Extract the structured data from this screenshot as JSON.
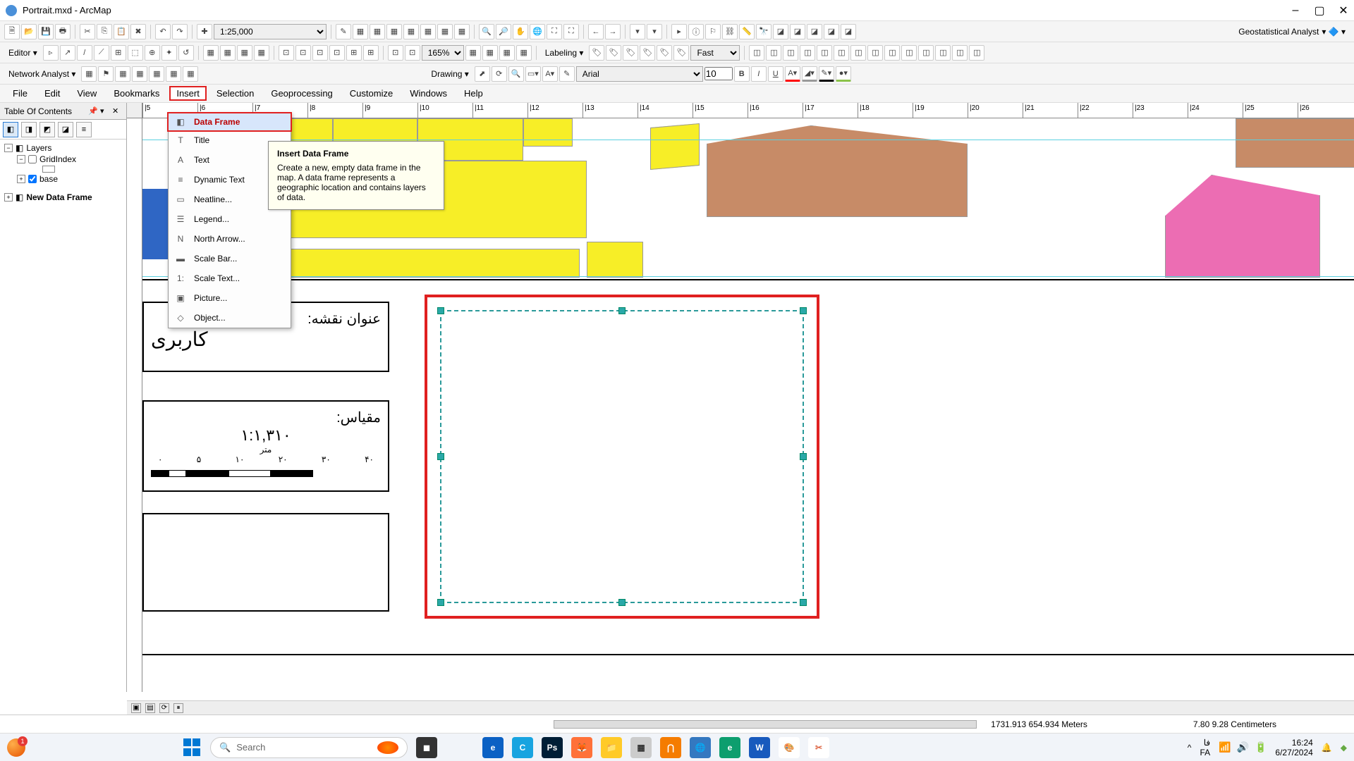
{
  "titlebar": {
    "title": "Portrait.mxd - ArcMap"
  },
  "toolbar1": {
    "scale": "1:25,000",
    "zoom": "165%",
    "geo_label": "Geostatistical Analyst"
  },
  "toolbar2": {
    "editor_label": "Editor",
    "labeling_label": "Labeling",
    "fast_label": "Fast"
  },
  "toolbar3": {
    "na_label": "Network Analyst",
    "draw_label": "Drawing",
    "font": "Arial",
    "fontsize": "10",
    "bold": "B",
    "italic": "I",
    "underline": "U"
  },
  "menubar": [
    "File",
    "Edit",
    "View",
    "Bookmarks",
    "Insert",
    "Selection",
    "Geoprocessing",
    "Customize",
    "Windows",
    "Help"
  ],
  "menubar_highlight_index": 4,
  "toc": {
    "title": "Table Of Contents",
    "layers_label": "Layers",
    "grid_label": "GridIndex",
    "base_label": "base",
    "new_frame_label": "New Data Frame"
  },
  "ruler_h": [
    "5",
    "6",
    "7",
    "8",
    "9",
    "10",
    "11",
    "12",
    "13",
    "14",
    "15",
    "16",
    "17",
    "18",
    "19",
    "20",
    "21",
    "22",
    "23",
    "24",
    "25",
    "26"
  ],
  "insert_menu": {
    "items": [
      {
        "label": "Data Frame",
        "icon": "◧"
      },
      {
        "label": "Title",
        "icon": "T"
      },
      {
        "label": "Text",
        "icon": "A"
      },
      {
        "label": "Dynamic Text",
        "icon": "≡",
        "arrow": true
      },
      {
        "label": "Neatline...",
        "icon": "▭"
      },
      {
        "label": "Legend...",
        "icon": "☰"
      },
      {
        "label": "North Arrow...",
        "icon": "N"
      },
      {
        "label": "Scale Bar...",
        "icon": "▬"
      },
      {
        "label": "Scale Text...",
        "icon": "1:"
      },
      {
        "label": "Picture...",
        "icon": "▣"
      },
      {
        "label": "Object...",
        "icon": "◇"
      }
    ],
    "highlight_index": 0
  },
  "tooltip": {
    "title": "Insert Data Frame",
    "body": "Create a new, empty data frame in the map. A data frame represents a geographic location and contains layers of data."
  },
  "layout": {
    "title_label": "عنوان نقشه:",
    "title_value": "کاربری",
    "scale_label": "مقیاس:",
    "scale_value": "۱:۱,۳۱۰",
    "unit": "متر",
    "scale_ticks": [
      "۰",
      "۵",
      "۱۰",
      "۲۰",
      "۳۰",
      "۴۰"
    ]
  },
  "status": {
    "coords": "1731.913  654.934 Meters",
    "cm": "7.80  9.28 Centimeters"
  },
  "taskbar": {
    "search_placeholder": "Search",
    "lang1": "فا",
    "lang2": "FA",
    "time": "16:24",
    "date": "6/27/2024",
    "badge": "1"
  }
}
